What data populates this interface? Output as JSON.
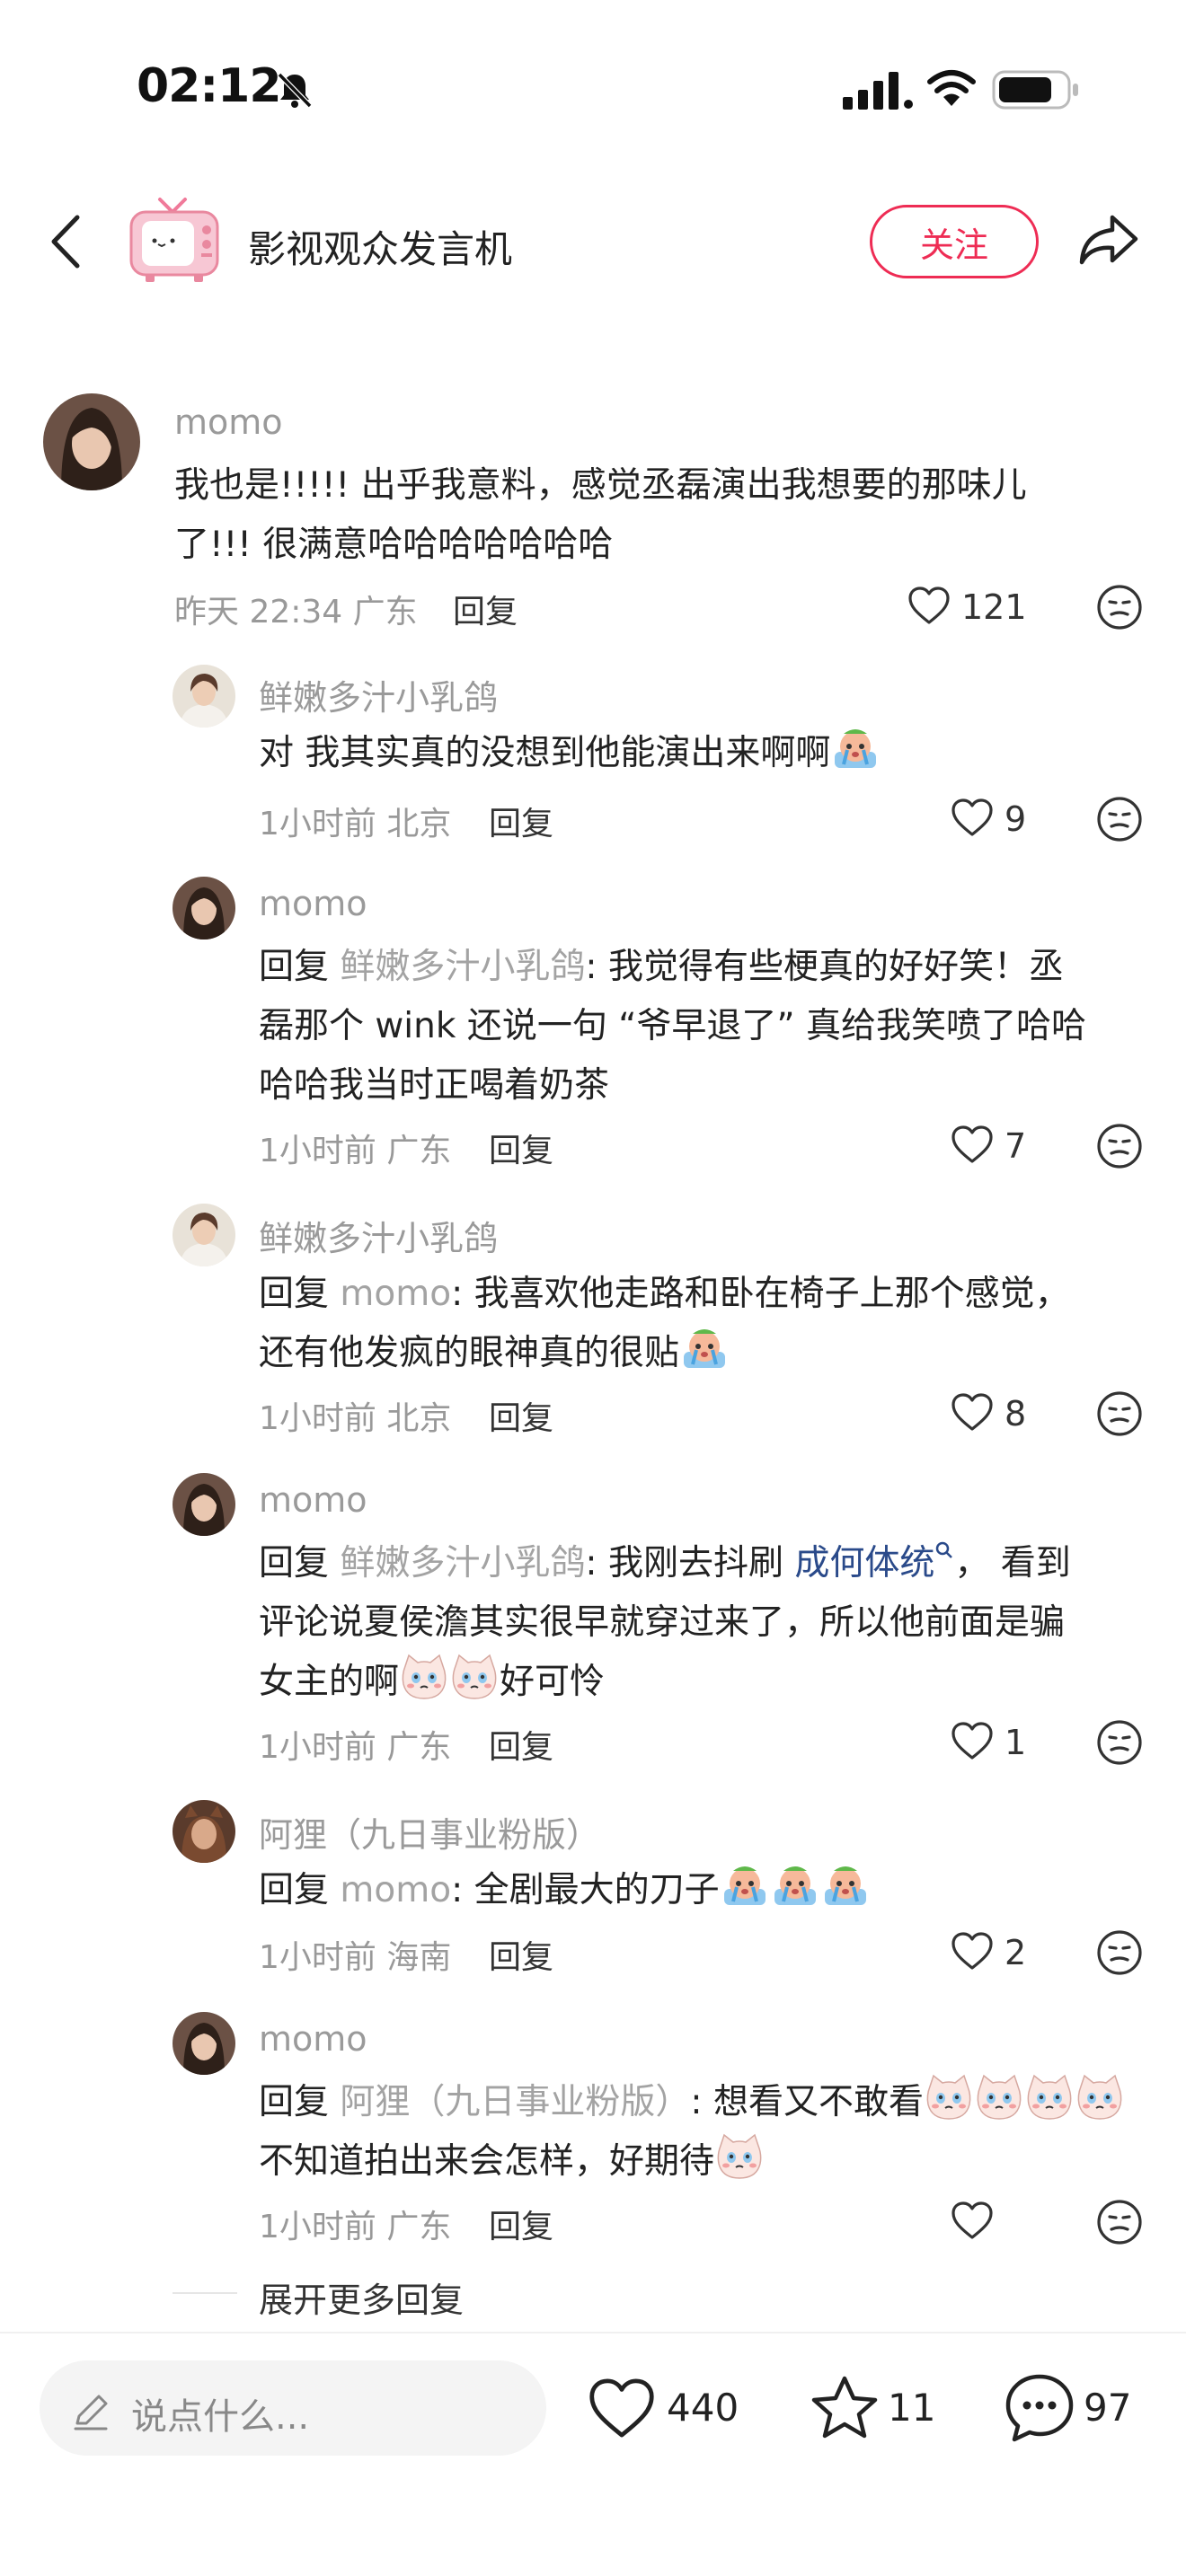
{
  "status_bar": {
    "time": "02:12"
  },
  "header": {
    "title": "影视观众发言机",
    "follow_label": "关注"
  },
  "comment": {
    "author": "momo",
    "text_line1": "我也是!!!!! 出乎我意料，感觉丞磊演出我想要的那味儿",
    "text_line2": "了!!! 很满意哈哈哈哈哈哈哈",
    "meta": "昨天 22:34 广东",
    "reply_label": "回复",
    "likes": "121"
  },
  "replies": [
    {
      "author": "鲜嫩多汁小乳鸽",
      "line1": "对 我其实真的没想到他能演出来啊啊",
      "meta": "1小时前 北京",
      "reply_label": "回复",
      "likes": "9"
    },
    {
      "author": "momo",
      "prefix": "回复 ",
      "mention": "鲜嫩多汁小乳鸽",
      "line1_rest": ": 我觉得有些梗真的好好笑！丞",
      "line2": "磊那个 wink 还说一句 “爷早退了” 真给我笑喷了哈哈",
      "line3": "哈哈我当时正喝着奶茶",
      "meta": "1小时前 广东",
      "reply_label": "回复",
      "likes": "7"
    },
    {
      "author": "鲜嫩多汁小乳鸽",
      "prefix": "回复 ",
      "mention": "momo",
      "line1_rest": ": 我喜欢他走路和卧在椅子上那个感觉，",
      "line2": "还有他发疯的眼神真的很贴",
      "meta": "1小时前 北京",
      "reply_label": "回复",
      "likes": "8"
    },
    {
      "author": "momo",
      "prefix": "回复 ",
      "mention": "鲜嫩多汁小乳鸽",
      "line1_mid": ": 我刚去抖刷 ",
      "topic": "成何体统",
      "line1_rest": "， 看到",
      "line2": "评论说夏侯澹其实很早就穿过来了，所以他前面是骗",
      "line3a": "女主的啊",
      "line3b": "好可怜",
      "meta": "1小时前 广东",
      "reply_label": "回复",
      "likes": "1"
    },
    {
      "author": "阿狸（九日事业粉版）",
      "prefix": "回复 ",
      "mention": "momo",
      "line1_rest": ": 全剧最大的刀子",
      "meta": "1小时前 海南",
      "reply_label": "回复",
      "likes": "2"
    },
    {
      "author": "momo",
      "prefix": "回复 ",
      "mention": "阿狸（九日事业粉版）",
      "line1_rest": ": 想看又不敢看",
      "line2": "不知道拍出来会怎样，好期待",
      "meta": "1小时前 广东",
      "reply_label": "回复"
    }
  ],
  "more_replies": "展开更多回复",
  "bottom_bar": {
    "input_placeholder": "说点什么...",
    "likes": "440",
    "stars": "11",
    "comments": "97"
  },
  "icons": {
    "back": "chevron-left-icon",
    "share": "share-arrow-icon",
    "heart": "heart-icon",
    "dislike": "neutral-face-icon",
    "star": "star-icon",
    "comment": "chat-bubble-icon",
    "pencil": "pencil-icon",
    "mute": "bell-slash-icon",
    "wifi": "wifi-icon",
    "battery": "battery-icon"
  },
  "colors": {
    "accent": "#ee2c54",
    "topic": "#2a4a8a",
    "meta": "#999999"
  }
}
